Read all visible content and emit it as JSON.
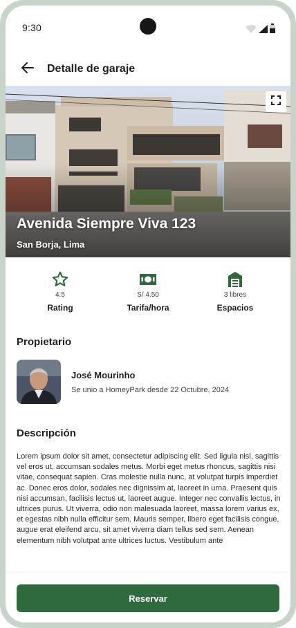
{
  "status_bar": {
    "time": "9:30",
    "icons": [
      "wifi-icon",
      "signal-icon",
      "battery-icon"
    ]
  },
  "app_bar": {
    "back_icon": "arrow-left-icon",
    "title": "Detalle de garaje"
  },
  "hero": {
    "title": "Avenida Siempre Viva 123",
    "subtitle": "San Borja, Lima",
    "expand_icon": "fullscreen-icon"
  },
  "stats": [
    {
      "icon": "star-icon",
      "value": "4.5",
      "label": "Rating"
    },
    {
      "icon": "banknote-icon",
      "value": "S/ 4.50",
      "label": "Tarifa/hora"
    },
    {
      "icon": "garage-icon",
      "value": "3 libres",
      "label": "Espacios"
    }
  ],
  "owner": {
    "section_title": "Propietario",
    "name": "José Mourinho",
    "since": "Se unio a HomeyPark desde 22 Octubre, 2024"
  },
  "description": {
    "section_title": "Descripción",
    "text": "Lorem ipsum dolor sit amet, consectetur adipiscing elit. Sed ligula nisl, sagittis vel eros ut, accumsan sodales metus. Morbi eget metus rhoncus, sagittis nisi vitae, consequat sapien. Cras molestie nulla nunc, at volutpat turpis imperdiet ac. Donec eros dolor, sodales nec dignissim at, laoreet in urna. Praesent quis nisi accumsan, facilisis lectus ut, laoreet augue. Integer nec convallis lectus, in ultrices purus. Ut viverra, odio non malesuada laoreet, massa lorem varius ex, et egestas nibh nulla efficitur sem. Mauris semper, libero eget facilisis congue, augue erat eleifend arcu, sit amet viverra diam tellus sed sem. Aenean elementum nibh volutpat ante ultrices luctus. Vestibulum ante"
  },
  "action": {
    "reserve_label": "Reservar"
  },
  "colors": {
    "accent": "#2e6a3c",
    "frame": "#c8d3c9"
  }
}
